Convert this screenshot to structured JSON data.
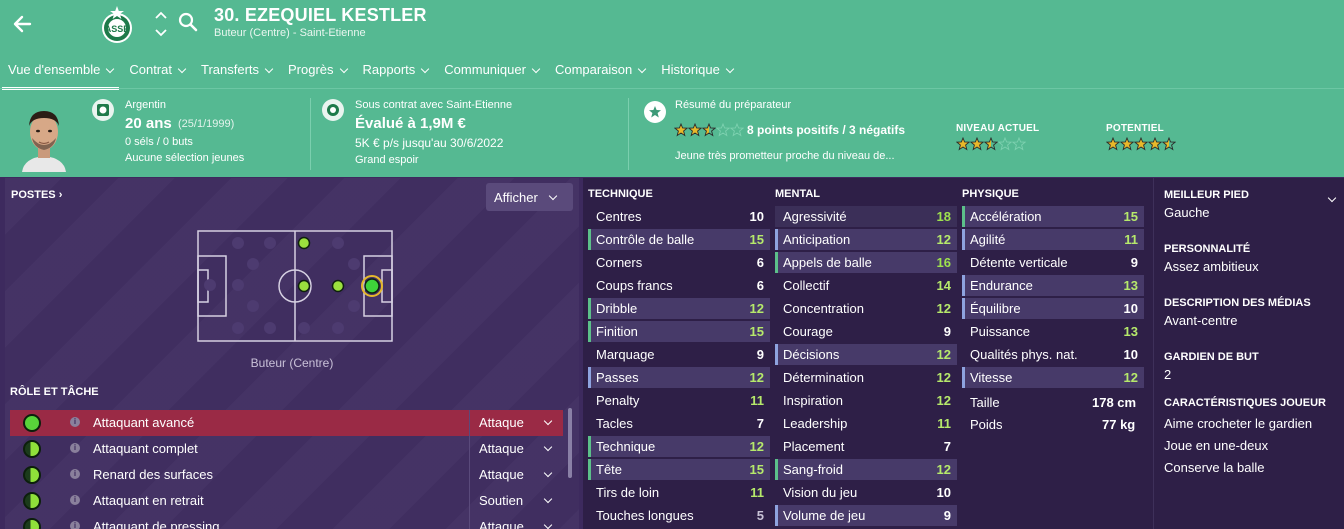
{
  "header": {
    "player_name": "30. EZEQUIEL KESTLER",
    "player_sub": "Buteur (Centre) - Saint-Etienne",
    "tabs": [
      {
        "label": "Vue d'ensemble"
      },
      {
        "label": "Contrat"
      },
      {
        "label": "Transferts"
      },
      {
        "label": "Progrès"
      },
      {
        "label": "Rapports"
      },
      {
        "label": "Communiquer"
      },
      {
        "label": "Comparaison"
      },
      {
        "label": "Historique"
      }
    ],
    "active_tab": "Vue d'ensemble",
    "bg_color": "#55b992"
  },
  "bio": {
    "nationality": "Argentin",
    "age": "20 ans",
    "dob": "(25/1/1999)",
    "caps": "0 séls / 0 buts",
    "youth_caps": "Aucune sélection jeunes"
  },
  "contract": {
    "line1": "Sous contrat avec Saint-Etienne",
    "value": "Évalué à 1,9M €",
    "wage": "5K € p/s jusqu'au 30/6/2022",
    "status": "Grand espoir"
  },
  "coach_report": {
    "title": "Résumé du préparateur",
    "stars_rating": 2.5,
    "summary": "8 points positifs / 3 négatifs",
    "text": "Jeune très prometteur proche du niveau de..."
  },
  "levels": {
    "current_label": "NIVEAU ACTUEL",
    "current_stars": 2.5,
    "potential_label": "POTENTIEL",
    "potential_stars": 4.5
  },
  "positions": {
    "title": "POSTES",
    "afficher": "Afficher",
    "label": "Buteur (Centre)"
  },
  "roles": {
    "title": "RÔLE ET TÂCHE",
    "items": [
      {
        "name": "Attaquant avancé",
        "duty": "Attaque"
      },
      {
        "name": "Attaquant complet",
        "duty": "Attaque"
      },
      {
        "name": "Renard des surfaces",
        "duty": "Attaque"
      },
      {
        "name": "Attaquant en retrait",
        "duty": "Soutien"
      },
      {
        "name": "Attaquant de pressing",
        "duty": "Attaque"
      }
    ]
  },
  "attributes": {
    "technique_title": "TECHNIQUE",
    "mental_title": "MENTAL",
    "physique_title": "PHYSIQUE",
    "technique": [
      {
        "name": "Centres",
        "value": "10"
      },
      {
        "name": "Contrôle de balle",
        "value": "15"
      },
      {
        "name": "Corners",
        "value": "6"
      },
      {
        "name": "Coups francs",
        "value": "6"
      },
      {
        "name": "Dribble",
        "value": "12"
      },
      {
        "name": "Finition",
        "value": "15"
      },
      {
        "name": "Marquage",
        "value": "9"
      },
      {
        "name": "Passes",
        "value": "12"
      },
      {
        "name": "Penalty",
        "value": "11"
      },
      {
        "name": "Tacles",
        "value": "7"
      },
      {
        "name": "Technique",
        "value": "12"
      },
      {
        "name": "Tête",
        "value": "15"
      },
      {
        "name": "Tirs de loin",
        "value": "11"
      },
      {
        "name": "Touches longues",
        "value": "5"
      }
    ],
    "mental": [
      {
        "name": "Agressivité",
        "value": "18"
      },
      {
        "name": "Anticipation",
        "value": "12"
      },
      {
        "name": "Appels de balle",
        "value": "16"
      },
      {
        "name": "Collectif",
        "value": "14"
      },
      {
        "name": "Concentration",
        "value": "12"
      },
      {
        "name": "Courage",
        "value": "9"
      },
      {
        "name": "Décisions",
        "value": "12"
      },
      {
        "name": "Détermination",
        "value": "12"
      },
      {
        "name": "Inspiration",
        "value": "12"
      },
      {
        "name": "Leadership",
        "value": "11"
      },
      {
        "name": "Placement",
        "value": "7"
      },
      {
        "name": "Sang-froid",
        "value": "12"
      },
      {
        "name": "Vision du jeu",
        "value": "10"
      },
      {
        "name": "Volume de jeu",
        "value": "9"
      }
    ],
    "physique": [
      {
        "name": "Accélération",
        "value": "15"
      },
      {
        "name": "Agilité",
        "value": "11"
      },
      {
        "name": "Détente verticale",
        "value": "9"
      },
      {
        "name": "Endurance",
        "value": "13"
      },
      {
        "name": "Équilibre",
        "value": "10"
      },
      {
        "name": "Puissance",
        "value": "13"
      },
      {
        "name": "Qualités phys. nat.",
        "value": "10"
      },
      {
        "name": "Vitesse",
        "value": "12"
      }
    ],
    "height_label": "Taille",
    "height": "178 cm",
    "weight_label": "Poids",
    "weight": "77 kg"
  },
  "profile": {
    "foot_title": "MEILLEUR PIED",
    "foot": "Gauche",
    "personality_title": "PERSONNALITÉ",
    "personality": "Assez ambitieux",
    "media_title": "DESCRIPTION DES MÉDIAS",
    "media": "Avant-centre",
    "gk_title": "GARDIEN DE BUT",
    "gk": "2",
    "traits_title": "CARACTÉRISTIQUES JOUEUR",
    "traits": [
      "Aime crocheter le gardien",
      "Joue en une-deux",
      "Conserve la balle"
    ]
  }
}
